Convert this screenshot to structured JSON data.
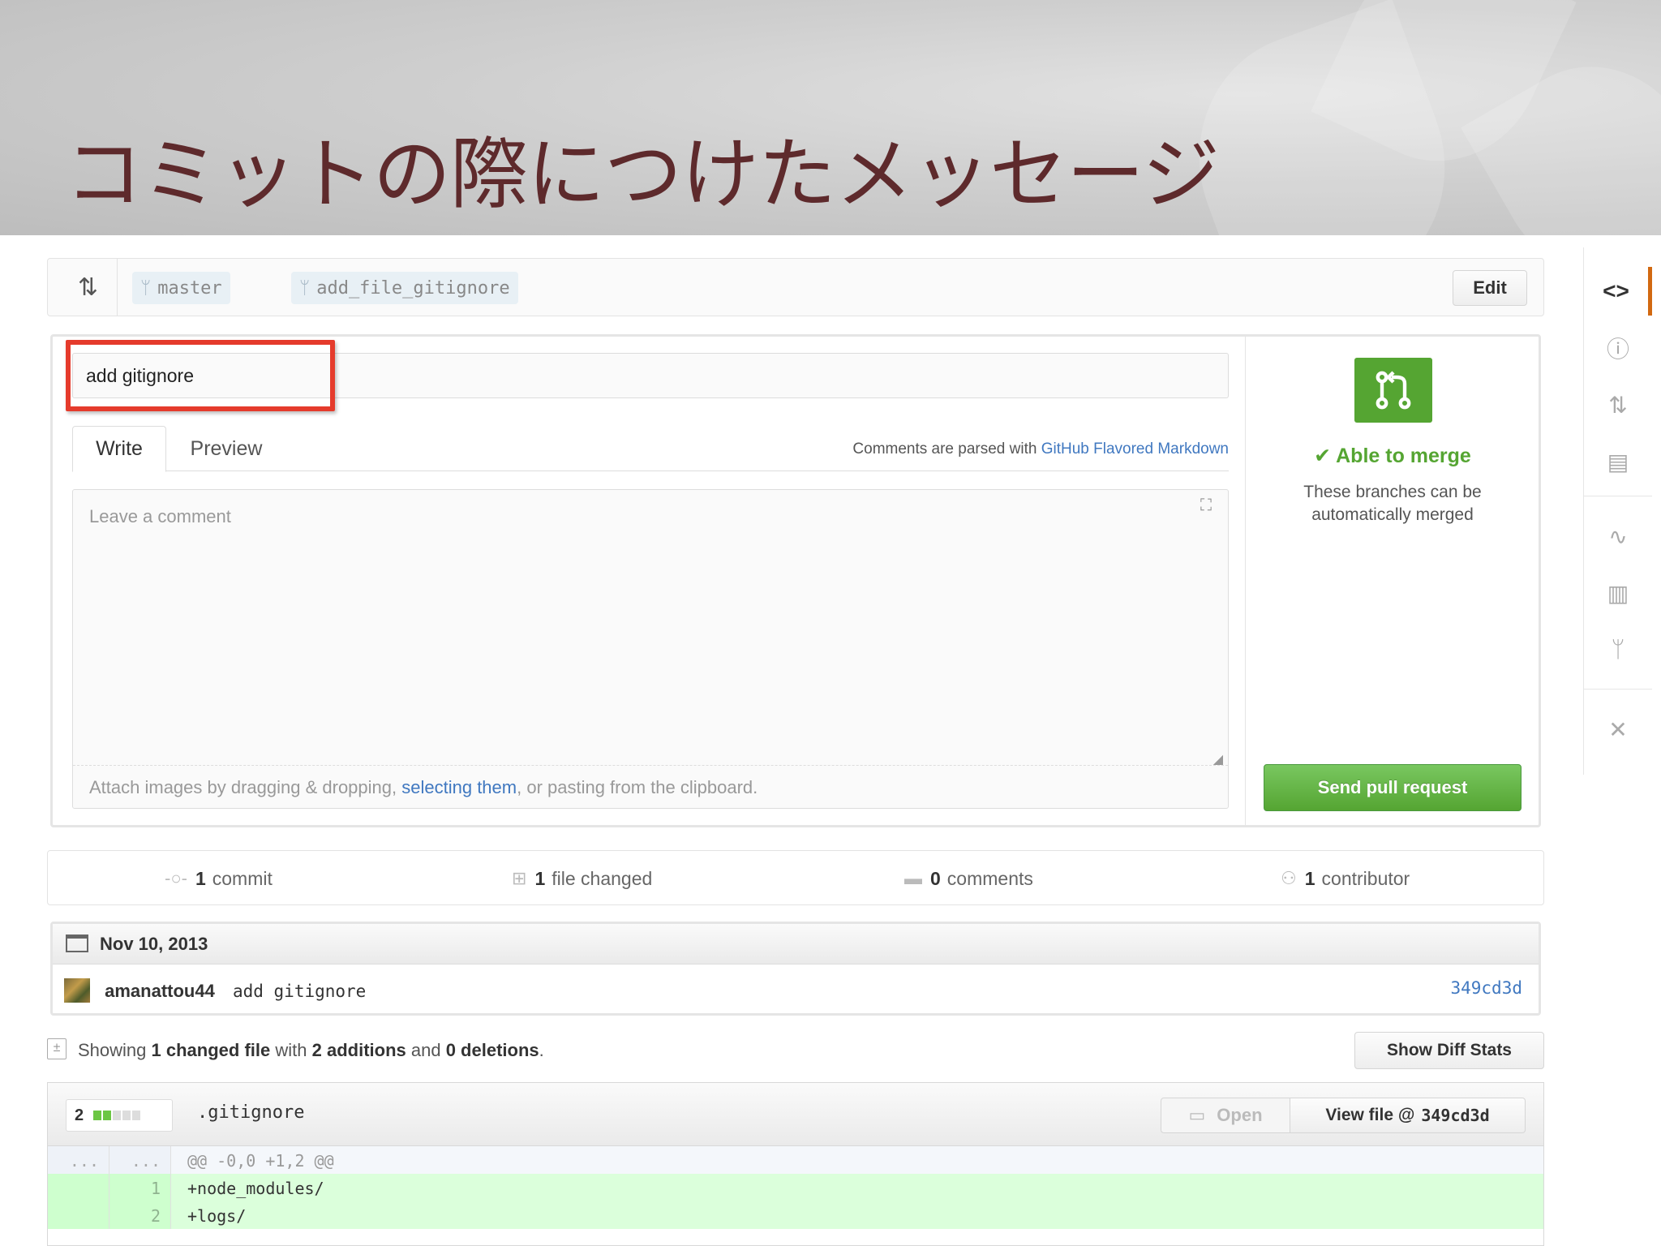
{
  "slide": {
    "title": "コミットの際につけたメッセージ"
  },
  "compare": {
    "base_branch": "master",
    "ellipsis": "...",
    "head_branch": "add_file_gitignore",
    "edit_label": "Edit"
  },
  "form": {
    "title_value": "add gitignore",
    "tabs": {
      "write": "Write",
      "preview": "Preview"
    },
    "markdown_note_prefix": "Comments are parsed with ",
    "markdown_link": "GitHub Flavored Markdown",
    "comment_placeholder": "Leave a comment",
    "attach_prefix": "Attach images by dragging & dropping, ",
    "attach_link": "selecting them",
    "attach_suffix": ", or pasting from the clipboard."
  },
  "merge": {
    "status": "✔ Able to merge",
    "description": "These branches can be automatically merged",
    "send_label": "Send pull request",
    "accent_color": "#55a532"
  },
  "summary": {
    "commits": {
      "count": "1",
      "label": "commit",
      "icon": "commit-icon"
    },
    "files": {
      "count": "1",
      "label": "file changed",
      "icon": "file-diff-icon"
    },
    "comments": {
      "count": "0",
      "label": "comments",
      "icon": "comment-icon"
    },
    "contributors": {
      "count": "1",
      "label": "contributor",
      "icon": "contributors-icon"
    }
  },
  "commits": {
    "date": "Nov 10, 2013",
    "rows": [
      {
        "author": "amanattou44",
        "message": "add gitignore",
        "sha": "349cd3d"
      }
    ]
  },
  "toc": {
    "showing": "Showing ",
    "changed_count": "1",
    "changed_label": " changed file",
    "with": " with ",
    "additions_count": "2",
    "additions_label": " additions",
    "and": " and ",
    "deletions_count": "0",
    "deletions_label": " deletions",
    "period": ".",
    "diff_stats_label": "Show Diff Stats"
  },
  "file": {
    "diffstat_count": "2",
    "name": ".gitignore",
    "open_label": "Open",
    "view_label": "View file @",
    "view_sha": "349cd3d",
    "hunk": {
      "n1": "...",
      "n2": "...",
      "code": "@@ -0,0 +1,2 @@"
    },
    "lines": [
      {
        "n1": "",
        "n2": "1",
        "code": "+node_modules/"
      },
      {
        "n1": "",
        "n2": "2",
        "code": "+logs/"
      }
    ]
  },
  "sidenav": {
    "items": [
      "code-icon",
      "issues-icon",
      "pull-request-icon",
      "wiki-icon",
      "pulse-icon",
      "graphs-icon",
      "network-icon",
      "settings-icon"
    ]
  }
}
